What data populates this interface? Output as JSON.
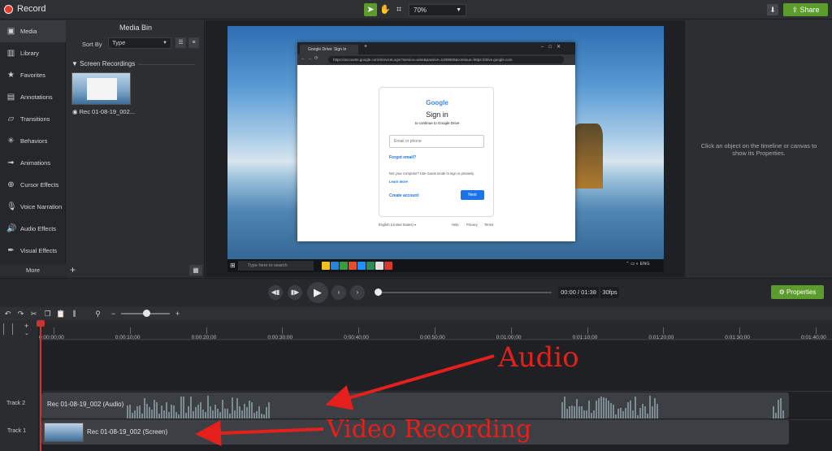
{
  "app": {
    "record_label": "Record",
    "zoom_level": "70%",
    "share_label": "Share"
  },
  "tools": {
    "items": [
      {
        "label": "Media",
        "icon": "film-icon"
      },
      {
        "label": "Library",
        "icon": "library-icon"
      },
      {
        "label": "Favorites",
        "icon": "star-icon"
      },
      {
        "label": "Annotations",
        "icon": "annotation-icon"
      },
      {
        "label": "Transitions",
        "icon": "transition-icon"
      },
      {
        "label": "Behaviors",
        "icon": "behavior-icon"
      },
      {
        "label": "Animations",
        "icon": "animation-icon"
      },
      {
        "label": "Cursor Effects",
        "icon": "cursor-icon"
      },
      {
        "label": "Voice Narration",
        "icon": "microphone-icon"
      },
      {
        "label": "Audio Effects",
        "icon": "speaker-icon"
      },
      {
        "label": "Visual Effects",
        "icon": "wand-icon"
      }
    ],
    "more_label": "More"
  },
  "media_bin": {
    "title": "Media Bin",
    "sort_by_label": "Sort By",
    "sort_value": "Type",
    "section_title": "Screen Recordings",
    "clip_name": "Rec 01-08-19_002..."
  },
  "canvas": {
    "browser_tab": "Google Drive: Sign in",
    "url": "https://accounts.google.com/ServiceLogin?service=wise&passive=1209600&continue=https://drive.google.com",
    "google": {
      "logo": "Google",
      "title": "Sign in",
      "subtitle": "to continue to Google Drive",
      "email_placeholder": "Email or phone",
      "forgot": "Forgot email?",
      "guest_text": "Not your computer? Use Guest mode to sign in privately.",
      "learn_more": "Learn more",
      "create": "Create account",
      "next": "Next",
      "language": "English (United States) ▾",
      "help": "Help",
      "privacy": "Privacy",
      "terms": "Terms"
    },
    "taskbar_search": "Type here to search",
    "taskbar_app_colors": [
      "#f0c020",
      "#2b82d8",
      "#3c9c3c",
      "#e54d2a",
      "#1e90ff",
      "#2e8b57",
      "#e0e0e0",
      "#d9382f"
    ]
  },
  "properties": {
    "empty_message": "Click an object on the timeline or canvas to show its Properties.",
    "button_label": "Properties"
  },
  "playback": {
    "time": "00:00 / 01:38",
    "fps": "30fps",
    "position_fraction": 0.0
  },
  "timeline": {
    "ticks": [
      "0:00:00;00",
      "0:00:10;00",
      "0:00:20;00",
      "0:00:30;00",
      "0:00:40;00",
      "0:00:50;00",
      "0:01:00;00",
      "0:01:10;00",
      "0:01:20;00",
      "0:01:30;00",
      "0:01:40;00"
    ],
    "track2_label": "Track 2",
    "track1_label": "Track 1",
    "audio_clip": "Rec 01-08-19_002 (Audio)",
    "video_clip": "Rec 01-08-19_002 (Screen)"
  },
  "annotations": {
    "audio": "Audio",
    "video": "Video Recording",
    "color": "#e5201c"
  }
}
